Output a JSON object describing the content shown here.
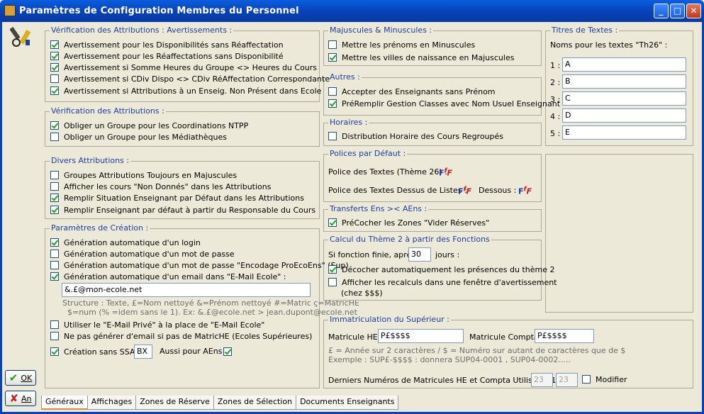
{
  "window": {
    "title": "Paramètres de Configuration Membres du Personnel",
    "min": "_",
    "max": "□",
    "close": "✕"
  },
  "side": {
    "ok": "OK",
    "cancel": "An"
  },
  "g_warn": {
    "title": "Vérification des Attributions : Avertissements :",
    "items": [
      {
        "label": "Avertissement pour les Disponibilités sans Réaffectation",
        "checked": true
      },
      {
        "label": "Avertissement pour les Réaffectations sans Disponibilité",
        "checked": true
      },
      {
        "label": "Avertissement si Somme Heures du Groupe <> Heures du Cours",
        "checked": true
      },
      {
        "label": "Avertissement si CDiv Dispo <> CDiv RéAffectation Correspondante",
        "checked": false
      },
      {
        "label": "Avertissement si Attributions à un Enseig. Non Présent dans Ecole",
        "checked": true
      }
    ]
  },
  "g_verif": {
    "title": "Vérification des Attributions :",
    "items": [
      {
        "label": "Obliger un Groupe pour les Coordinations NTPP",
        "checked": true
      },
      {
        "label": "Obliger un Groupe pour les Médiathèques",
        "checked": false
      }
    ]
  },
  "g_divers": {
    "title": "Divers Attributions :",
    "items": [
      {
        "label": "Groupes Attributions Toujours en Majuscules",
        "checked": false
      },
      {
        "label": "Afficher les cours \"Non Donnés\" dans les Attributions",
        "checked": false
      },
      {
        "label": "Remplir Situation Enseignant par Défaut  dans les Attributions",
        "checked": true
      },
      {
        "label": "Remplir Enseignant par défaut à partir du Responsable du Cours",
        "checked": true
      }
    ]
  },
  "g_creation": {
    "title": "Paramètres de Création :",
    "items": [
      {
        "label": "Génération automatique d'un login",
        "checked": true
      },
      {
        "label": "Génération automatique d'un mot de passe",
        "checked": false
      },
      {
        "label": "Génération automatique d'un mot de passe \"Encodage ProEcoEns\" (Sup)",
        "checked": false
      },
      {
        "label": "Génération automatique d'un email dans \"E-Mail Ecole\" :",
        "checked": true
      }
    ],
    "email_value": "&.£@mon-ecole.net",
    "structure1": "Structure : Texte, £=Nom nettoyé &=Prénom nettoyé  #=Matric  ç=MatricHE",
    "structure2": "$=num (% =idem sans le 1).  Ex: &.£@ecole.net > jean.dupont@ecole.net",
    "items2": [
      {
        "label": "Utiliser le \"E-Mail Privé\" à la place de \"E-Mail Ecole\"",
        "checked": false
      },
      {
        "label": "Ne pas générer d'email si pas de MatricHE (Ecoles Supérieures)",
        "checked": false
      }
    ],
    "ssa_label": "Création sans SSA :",
    "ssa_checked": true,
    "ssa_value": "BX",
    "aens_label": "Aussi pour AEns :",
    "aens_checked": true
  },
  "g_maj": {
    "title": "Majuscules & Minuscules :",
    "items": [
      {
        "label": "Mettre les prénoms en Minuscules",
        "checked": false
      },
      {
        "label": "Mettre les villes de naissance en Majuscules",
        "checked": true
      }
    ]
  },
  "g_autres": {
    "title": "Autres :",
    "items": [
      {
        "label": "Accepter des Enseignants sans Prénom",
        "checked": false
      },
      {
        "label": "PréRemplir Gestion Classes avec Nom Usuel Enseignant",
        "checked": true
      }
    ]
  },
  "g_horaires": {
    "title": "Horaires :",
    "items": [
      {
        "label": "Distribution Horaire des Cours Regroupés",
        "checked": false
      }
    ]
  },
  "g_polices": {
    "title": "Polices par Défaut :",
    "textes": "Police des Textes (Thème 26) :",
    "dessus": "Police des Textes Dessus de Listes :",
    "dessous": "Dessous :",
    "icon": "F",
    "icon2": "f",
    "icon3": "F"
  },
  "g_transferts": {
    "title": "Transferts Ens >< AEns :",
    "items": [
      {
        "label": "PréCocher les Zones \"Vider Réserves\"",
        "checked": true
      }
    ]
  },
  "g_calcul": {
    "title": "Calcul du Thème 2 à partir des Fonctions",
    "si": "Si fonction finie, après",
    "jours_value": "30",
    "jours": "jours :",
    "items": [
      {
        "label": "Décocher automatiquement les présences du thème 2",
        "checked": true
      },
      {
        "label": "Afficher les recalculs dans une fenêtre d'avertissement",
        "checked": false
      }
    ],
    "chez": "(chez $$$)"
  },
  "g_titres": {
    "title": "Titres de Textes :",
    "subtitle": "Noms pour les textes \"Th26\" :",
    "rows": [
      {
        "n": "1 :",
        "v": "A"
      },
      {
        "n": "2 :",
        "v": "B"
      },
      {
        "n": "3 :",
        "v": "C"
      },
      {
        "n": "4 :",
        "v": "D"
      },
      {
        "n": "5 :",
        "v": "E"
      }
    ]
  },
  "g_immat": {
    "title": "Immatriculation du Supérieur :",
    "he_label": "Matricule HE :",
    "he_value": "P£$$$$",
    "compta_label": "Matricule Compta :",
    "compta_value": "P£$$$$",
    "note1": "£ = Année sur 2 caractères / $ = Numéro sur autant de caractères que de $",
    "note2": "Exemple : SUP£-$$$$ : donnera SUP04-0001 , SUP04-0002.....",
    "derniers": "Derniers Numéros de Matricules HE et Compta Utilisés :01 :",
    "d1": "23",
    "d2": "23",
    "modifier": "Modifier",
    "modifier_checked": false
  },
  "tabs": [
    "Généraux",
    "Affichages",
    "Zones de Réserve",
    "Zones de Sélection",
    "Documents Enseignants"
  ]
}
